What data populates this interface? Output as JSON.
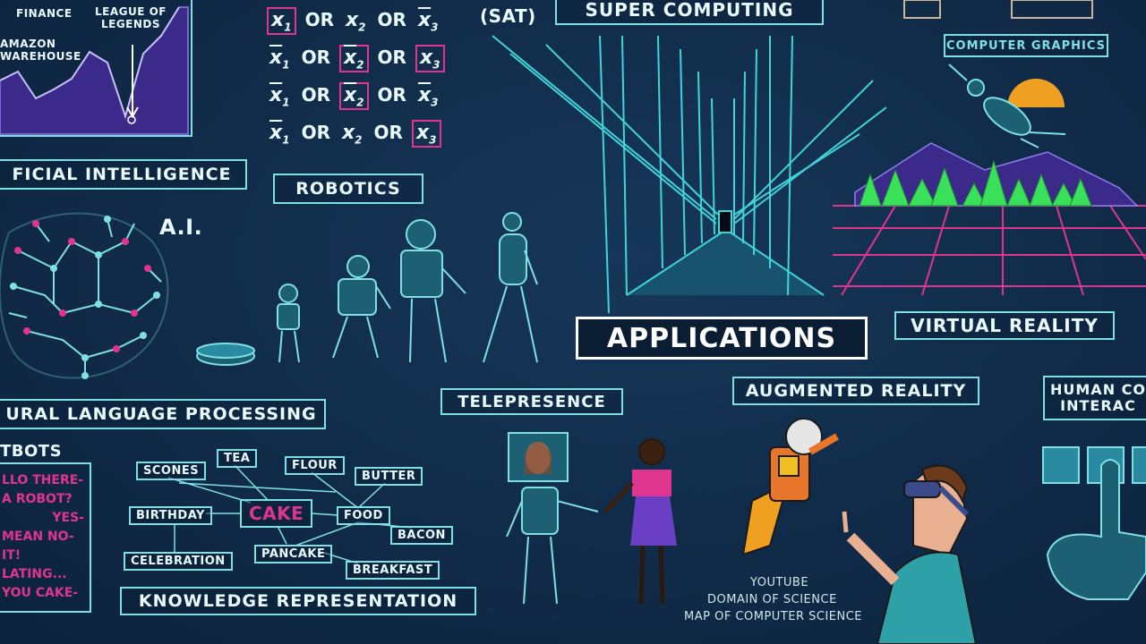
{
  "labels": {
    "finance": "FINANCE",
    "league": "LEAGUE OF\nLEGENDS",
    "amazon": "AMAZON\nWAREHOUSE",
    "ai_header": "FICIAL INTELLIGENCE",
    "ai_mark": "A.I.",
    "robotics": "ROBOTICS",
    "super_computing": "SUPER COMPUTING",
    "sat": "(SAT)",
    "computer_graphics": "COMPUTER GRAPHICS",
    "virtual_reality": "VIRTUAL REALITY",
    "applications": "APPLICATIONS",
    "nlp": "URAL LANGUAGE PROCESSING",
    "chatbots": "TBOTS",
    "telepresence": "TELEPRESENCE",
    "augmented_reality": "AUGMENTED REALITY",
    "hci": "HUMAN CO\nINTERAC",
    "knowledge_representation": "KNOWLEDGE REPRESENTATION",
    "credit_1": "YOUTUBE",
    "credit_2": "DOMAIN OF SCIENCE",
    "credit_3": "MAP OF COMPUTER SCIENCE"
  },
  "chatbot_lines": [
    "LLO THERE-",
    "A ROBOT?",
    "YES-",
    "MEAN NO-",
    "IT!",
    "LATING...",
    "YOU CAKE-"
  ],
  "sat_rows": [
    [
      {
        "n": "x",
        "s": "1",
        "neg": false,
        "hl": true
      },
      {
        "n": "x",
        "s": "2",
        "neg": false,
        "hl": false
      },
      {
        "n": "x",
        "s": "3",
        "neg": true,
        "hl": false
      }
    ],
    [
      {
        "n": "x",
        "s": "1",
        "neg": true,
        "hl": false
      },
      {
        "n": "x",
        "s": "2",
        "neg": true,
        "hl": true
      },
      {
        "n": "x",
        "s": "3",
        "neg": false,
        "hl": true
      }
    ],
    [
      {
        "n": "x",
        "s": "1",
        "neg": true,
        "hl": false
      },
      {
        "n": "x",
        "s": "2",
        "neg": true,
        "hl": true
      },
      {
        "n": "x",
        "s": "3",
        "neg": true,
        "hl": false
      }
    ],
    [
      {
        "n": "x",
        "s": "1",
        "neg": true,
        "hl": false
      },
      {
        "n": "x",
        "s": "2",
        "neg": false,
        "hl": false
      },
      {
        "n": "x",
        "s": "3",
        "neg": false,
        "hl": true
      }
    ]
  ],
  "sat_or": "OR",
  "knowledge_nodes": {
    "scones": "SCONES",
    "tea": "TEA",
    "flour": "FLOUR",
    "butter": "BUTTER",
    "birthday": "BIRTHDAY",
    "cake": "CAKE",
    "food": "FOOD",
    "bacon": "BACON",
    "celebration": "CELEBRATION",
    "pancake": "PANCAKE",
    "breakfast": "BREAKFAST"
  },
  "colors": {
    "cyan": "#7fe0e4",
    "magenta": "#e0358f",
    "purple": "#6a3fc4",
    "green": "#39e05a",
    "sun": "#f0a020",
    "background": "#112d4b"
  }
}
